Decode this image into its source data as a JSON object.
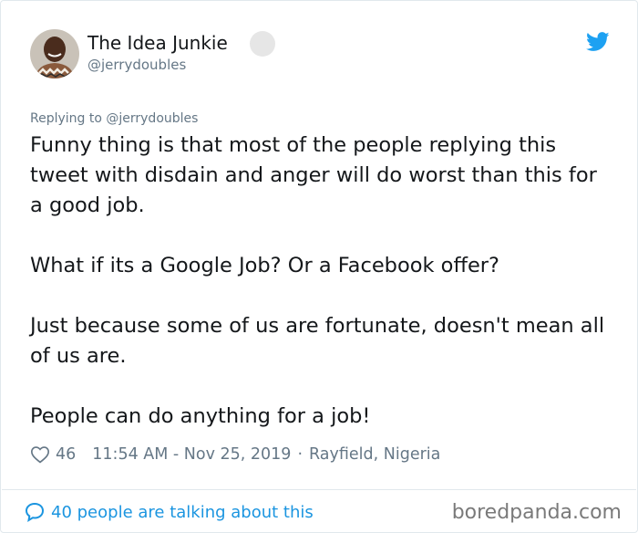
{
  "tweet": {
    "author_name": "The Idea Junkie",
    "author_handle": "@jerrydoubles",
    "replying_to": "Replying to @jerrydoubles",
    "paragraphs": [
      "Funny thing is that most of the people replying this tweet with disdain and anger will do worst than this for a good job.",
      "What if its a Google Job? Or a Facebook offer?",
      "Just because some of us are fortunate, doesn't mean all of us are.",
      "People can do anything for a job!"
    ],
    "likes": "46",
    "timestamp": "11:54 AM - Nov 25, 2019",
    "separator": "·",
    "location": "Rayfield, Nigeria",
    "conversation": "40 people are talking about this"
  },
  "watermark": "boredpanda.com",
  "icons": {
    "logo": "twitter-bird-icon",
    "like": "heart-icon",
    "reply": "speech-bubble-icon",
    "verified": "verified-badge-icon"
  },
  "colors": {
    "twitter_blue": "#1da1f2",
    "link_blue": "#1b95e0",
    "muted_text": "#657786",
    "primary_text": "#14171a",
    "border": "#e1e8ed"
  }
}
